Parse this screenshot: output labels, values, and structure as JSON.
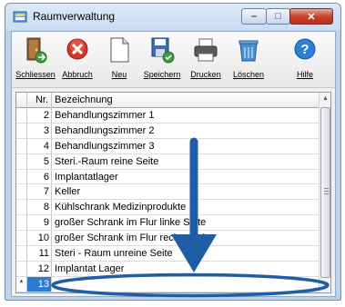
{
  "window": {
    "title": "Raumverwaltung",
    "controls": {
      "minimize": "–",
      "maximize": "□",
      "close": "✕"
    }
  },
  "toolbar": {
    "items": [
      {
        "label": "Schliessen",
        "icon": "door-exit-icon"
      },
      {
        "label": "Abbruch",
        "icon": "cancel-icon"
      },
      {
        "label": "Neu",
        "icon": "new-document-icon"
      },
      {
        "label": "Speichern",
        "icon": "save-icon"
      },
      {
        "label": "Drucken",
        "icon": "printer-icon"
      },
      {
        "label": "Löschen",
        "icon": "delete-trash-icon"
      },
      {
        "label": "Hilfe",
        "icon": "help-icon"
      }
    ]
  },
  "grid": {
    "headers": {
      "nr": "Nr.",
      "bezeichnung": "Bezeichnung"
    },
    "rows": [
      {
        "marker": "",
        "nr": "2",
        "bezeichnung": "Behandlungszimmer 1"
      },
      {
        "marker": "",
        "nr": "3",
        "bezeichnung": "Behandlungszimmer 2"
      },
      {
        "marker": "",
        "nr": "4",
        "bezeichnung": "Behandlungszimmer 3"
      },
      {
        "marker": "",
        "nr": "5",
        "bezeichnung": "Steri.-Raum reine Seite"
      },
      {
        "marker": "",
        "nr": "6",
        "bezeichnung": "Implantatlager"
      },
      {
        "marker": "",
        "nr": "7",
        "bezeichnung": "Keller"
      },
      {
        "marker": "",
        "nr": "8",
        "bezeichnung": "Kühlschrank Medizinprodukte"
      },
      {
        "marker": "",
        "nr": "9",
        "bezeichnung": "großer Schrank im Flur linke Seite"
      },
      {
        "marker": "",
        "nr": "10",
        "bezeichnung": "großer Schrank im Flur rechte Seite"
      },
      {
        "marker": "",
        "nr": "11",
        "bezeichnung": "Steri - Raum unreine Seite"
      },
      {
        "marker": "",
        "nr": "12",
        "bezeichnung": "Implantat Lager"
      },
      {
        "marker": "*",
        "nr": "13",
        "bezeichnung": ""
      }
    ]
  },
  "colors": {
    "selection": "#2b7bd3",
    "annotation": "#1f5da6"
  }
}
